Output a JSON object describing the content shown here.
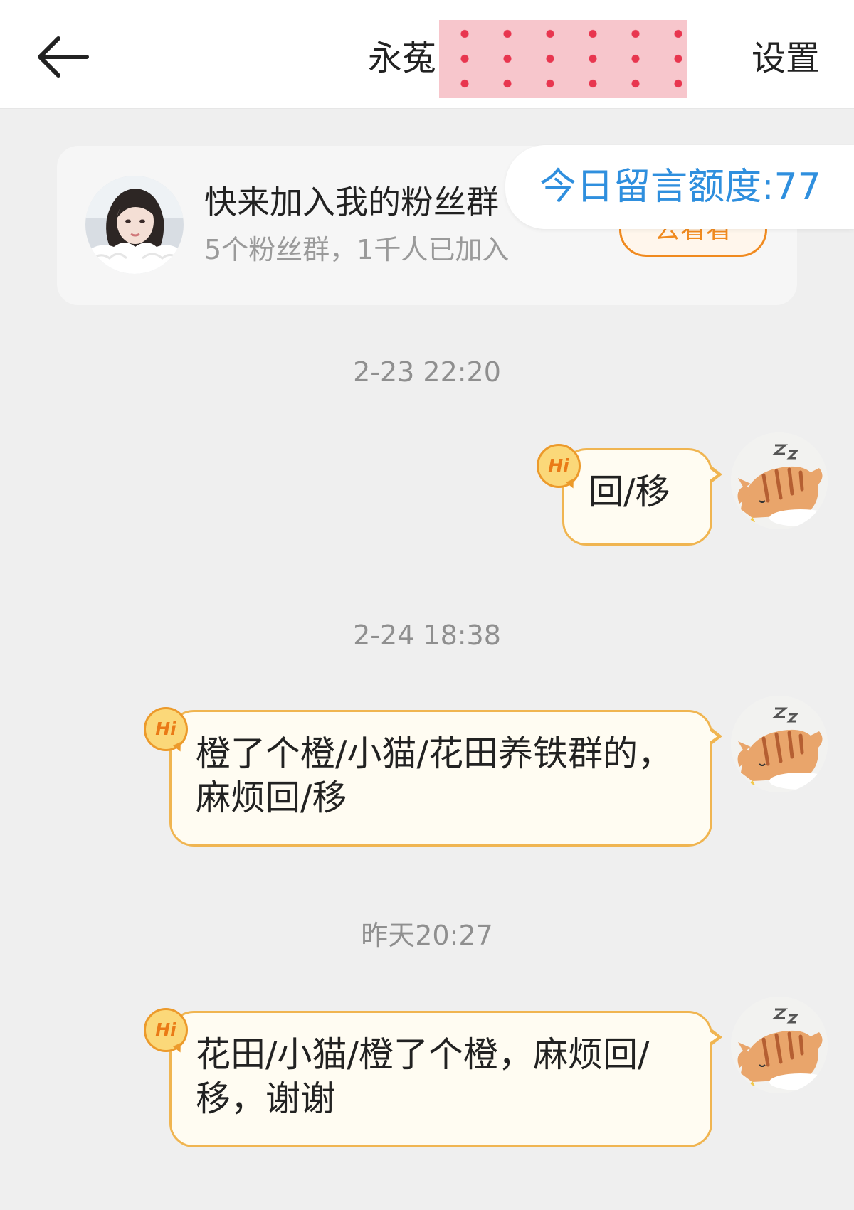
{
  "header": {
    "title": "永菟",
    "settings_label": "设置"
  },
  "fan_group": {
    "title": "快来加入我的粉丝群",
    "subtitle": "5个粉丝群，1千人已加入",
    "button_label": "去看看",
    "quota_label": "今日留言额度:77"
  },
  "messages": [
    {
      "time": "2-23 22:20",
      "badge": "Hi",
      "text": "回/移"
    },
    {
      "time": "2-24 18:38",
      "badge": "Hi",
      "text": "橙了个橙/小猫/花田养铁群的，麻烦回/移"
    },
    {
      "time": "昨天20:27",
      "badge": "Hi",
      "text": "花田/小猫/橙了个橙，麻烦回/移，谢谢"
    }
  ],
  "colors": {
    "accent": "#f08a1f",
    "link_blue": "#2f8fde",
    "bubble_border": "#f0b551",
    "bubble_fill": "#fffcf2"
  },
  "icons": [
    "back-arrow-icon",
    "hi-badge-icon",
    "avatar",
    "cat-avatar"
  ]
}
